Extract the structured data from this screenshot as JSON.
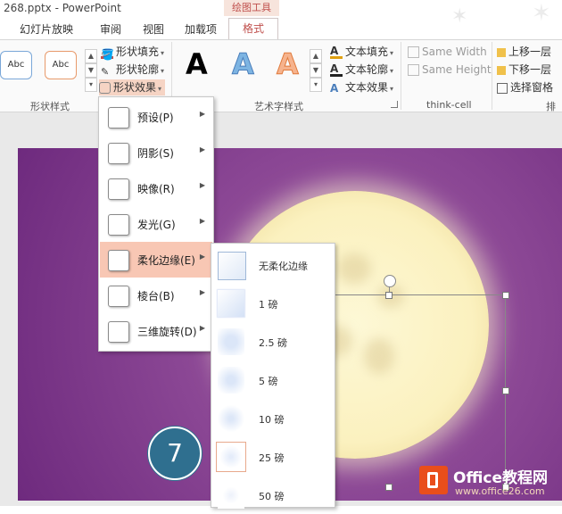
{
  "window": {
    "title": "268.pptx - PowerPoint",
    "context_group": "绘图工具"
  },
  "tabs": [
    "幻灯片放映",
    "审阅",
    "视图",
    "加载项"
  ],
  "active_tab": "格式",
  "ribbon": {
    "shape_styles": {
      "preview1": "Abc",
      "preview2": "Abc",
      "label": "形状样式"
    },
    "shape_cmds": {
      "fill": "形状填充",
      "outline": "形状轮廓",
      "effects": "形状效果"
    },
    "wordart": {
      "letter": "A",
      "label": "艺术字样式"
    },
    "text_cmds": {
      "fill": "文本填充",
      "outline": "文本轮廓",
      "effects": "文本效果"
    },
    "thinkcell": {
      "same_width": "Same Width",
      "same_height": "Same Height",
      "label": "think-cell"
    },
    "arrange": {
      "bring_forward": "上移一层",
      "send_backward": "下移一层",
      "selection_pane": "选择窗格",
      "label": "排"
    }
  },
  "menu": {
    "items": [
      {
        "label": "预设(P)"
      },
      {
        "label": "阴影(S)"
      },
      {
        "label": "映像(R)"
      },
      {
        "label": "发光(G)"
      },
      {
        "label": "柔化边缘(E)"
      },
      {
        "label": "棱台(B)"
      },
      {
        "label": "三维旋转(D)"
      }
    ]
  },
  "submenu": {
    "items": [
      {
        "label": "无柔化边缘"
      },
      {
        "label": "1 磅"
      },
      {
        "label": "2.5 磅"
      },
      {
        "label": "5 磅"
      },
      {
        "label": "10 磅"
      },
      {
        "label": "25 磅"
      },
      {
        "label": "50 磅"
      }
    ]
  },
  "badge": "7",
  "watermark": {
    "main": "Office教程网",
    "url": "www.office26.com"
  },
  "colors": {
    "accent": "#c0504d",
    "slide_bg": "#8e4a97",
    "moon": "#fbf1bf",
    "badge": "#2f6f8f",
    "hover": "#f8c7b4"
  }
}
